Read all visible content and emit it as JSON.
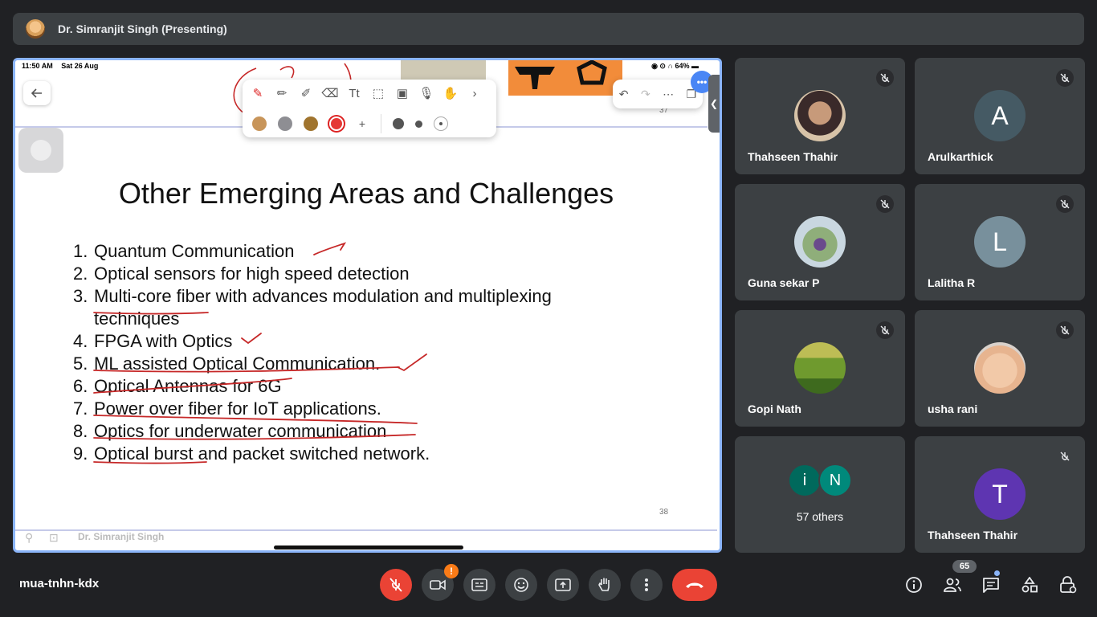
{
  "presenter": {
    "name": "Dr. Simranjit Singh (Presenting)"
  },
  "screen": {
    "status_time": "11:50 AM",
    "status_date": "Sat 26 Aug",
    "battery": "64%",
    "prev_slide_number": "37",
    "slide_title": "Other Emerging Areas and Challenges",
    "slide_items": [
      {
        "num": "1.",
        "text": "Quantum Communication"
      },
      {
        "num": "2.",
        "text": "Optical sensors for high speed detection"
      },
      {
        "num": "3.",
        "text": "Multi-core fiber with advances modulation and multiplexing techniques"
      },
      {
        "num": "4.",
        "text": "FPGA with Optics"
      },
      {
        "num": "5.",
        "text": "ML assisted Optical Communication."
      },
      {
        "num": "6.",
        "text": "Optical Antennas for 6G"
      },
      {
        "num": "7.",
        "text": "Power over fiber for IoT applications."
      },
      {
        "num": "8.",
        "text": "Optics for underwater communication"
      },
      {
        "num": "9.",
        "text": "Optical burst and packet switched network."
      }
    ],
    "slide_number": "38",
    "footer_name": "Dr. Simranjit Singh",
    "ink_color": "#c62828",
    "pen_colors": [
      "#c8955a",
      "#8e8e93",
      "#a0742e",
      "#e53935"
    ]
  },
  "participants": [
    {
      "name": "Thahseen Thahir",
      "type": "photo",
      "muted": true
    },
    {
      "name": "Arulkarthick",
      "initial": "A",
      "color": "#455a64",
      "muted": true
    },
    {
      "name": "Guna sekar P",
      "type": "photo",
      "muted": true
    },
    {
      "name": "Lalitha R",
      "initial": "L",
      "color": "#78909c",
      "muted": true
    },
    {
      "name": "Gopi Nath",
      "type": "photo",
      "muted": true
    },
    {
      "name": "usha rani",
      "type": "photo",
      "muted": true
    },
    {
      "name": "Thahseen Thahir",
      "initial": "T",
      "color": "#5e35b1",
      "muted": true
    }
  ],
  "others": {
    "initials": [
      "i",
      "N"
    ],
    "colors": [
      "#00695c",
      "#00897b"
    ],
    "label": "57 others"
  },
  "meeting": {
    "code": "mua-tnhn-kdx",
    "people_count": "65",
    "camera_warning": "!"
  }
}
